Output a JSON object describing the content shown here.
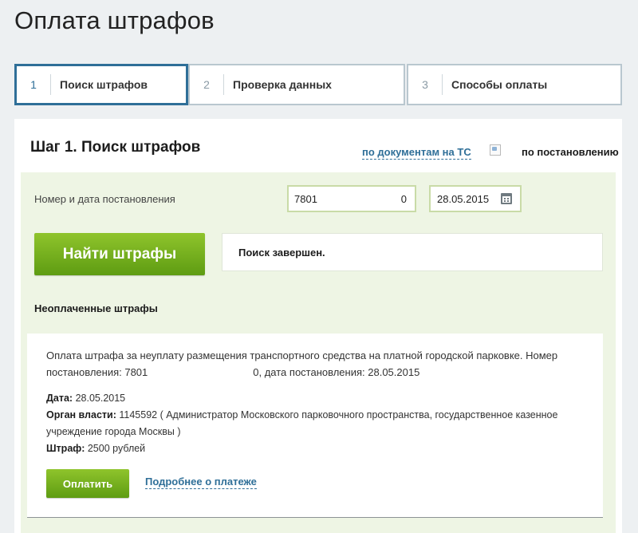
{
  "page": {
    "title": "Оплата штрафов"
  },
  "steps": [
    {
      "num": "1",
      "label": "Поиск штрафов",
      "active": true
    },
    {
      "num": "2",
      "label": "Проверка данных",
      "active": false
    },
    {
      "num": "3",
      "label": "Способы оплаты",
      "active": false
    }
  ],
  "card": {
    "title": "Шаг 1. Поиск штрафов",
    "link_docs": "по документам на ТС",
    "link_decree": "по постановлению"
  },
  "form": {
    "field_label": "Номер и дата постановления",
    "number_part1": "7801",
    "number_part2": "0",
    "date_value": "28.05.2015",
    "find_button": "Найти штрафы",
    "status": "Поиск завершен."
  },
  "results": {
    "section_title": "Неоплаченные штрафы",
    "fine": {
      "desc_part1": "Оплата штрафа за неуплату размещения транспортного средства на платной городской парковке. Номер постановления: 7801",
      "desc_part2": "0, дата постановления: 28.05.2015",
      "date_label": "Дата:",
      "date_value": "28.05.2015",
      "authority_label": "Орган власти:",
      "authority_value": "1145592 ( Администратор Московского парковочного пространства, государственное казенное учреждение города Москвы )",
      "amount_label": "Штраф:",
      "amount_value": "2500 рублей",
      "pay_button": "Оплатить",
      "more_link": "Подробнее о платеже"
    }
  },
  "colors": {
    "accent": "#2f6f98",
    "button_green": "#6aa61a",
    "form_bg": "#eef5e4",
    "page_bg": "#edf0f2"
  },
  "icons": {
    "calendar": "calendar-icon",
    "broken_image": "broken-image-icon"
  }
}
